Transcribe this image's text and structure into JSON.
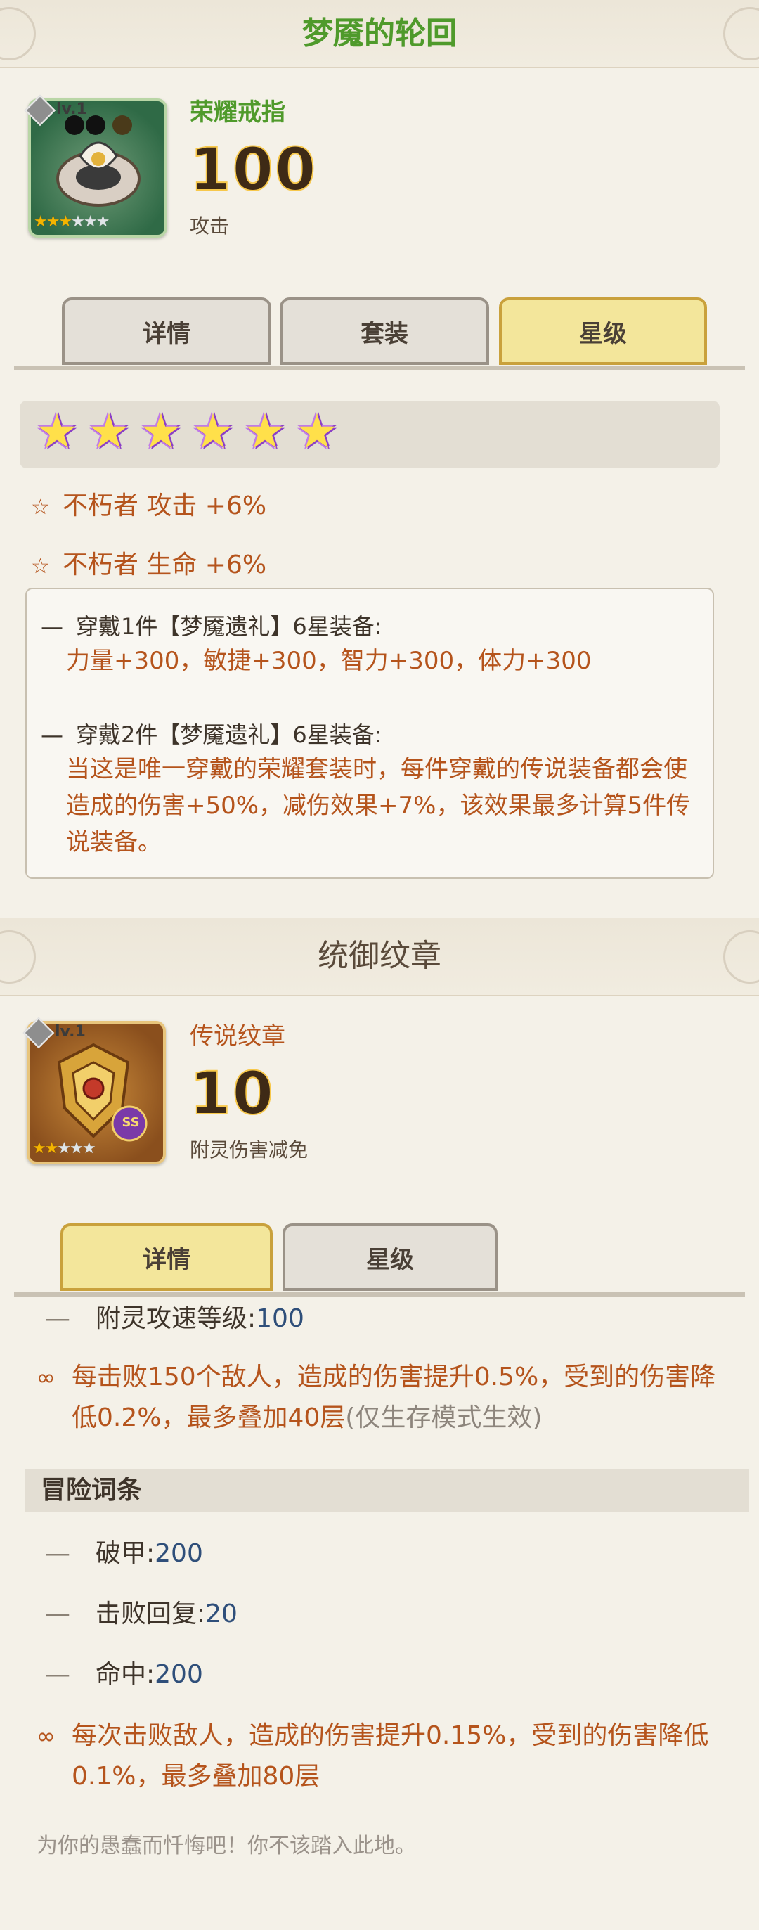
{
  "panel1": {
    "title": "梦魇的轮回",
    "item": {
      "level": "lv.1",
      "name": "荣耀戒指",
      "value": "100",
      "stat": "攻击",
      "stars_filled": 3,
      "stars_total": 6
    },
    "tabs": [
      {
        "label": "详情",
        "active": false
      },
      {
        "label": "套装",
        "active": false
      },
      {
        "label": "星级",
        "active": true
      }
    ],
    "star_count": 6,
    "bonuses": [
      "不朽者 攻击 +6%",
      "不朽者 生命 +6%"
    ],
    "set_bonuses": [
      {
        "head": "穿戴1件【梦魇遗礼】6星装备:",
        "body": "力量+300，敏捷+300，智力+300，体力+300"
      },
      {
        "head": "穿戴2件【梦魇遗礼】6星装备:",
        "body": "当这是唯一穿戴的荣耀套装时，每件穿戴的传说装备都会使造成的伤害+50%，减伤效果+7%，该效果最多计算5件传说装备。"
      }
    ]
  },
  "panel2": {
    "title": "统御纹章",
    "item": {
      "level": "lv.1",
      "name": "传说纹章",
      "value": "10",
      "stat": "附灵伤害减免",
      "badge": "SS",
      "stars_filled": 2,
      "stars_total": 5
    },
    "tabs": [
      {
        "label": "详情",
        "active": true
      },
      {
        "label": "星级",
        "active": false
      }
    ],
    "stats_top": [
      {
        "label": "附灵攻速等级:",
        "value": "100"
      }
    ],
    "effect1": {
      "main": "每击败150个敌人，造成的伤害提升0.5%，受到的伤害降低0.2%，最多叠加40层",
      "note": "(仅生存模式生效)"
    },
    "section_title": "冒险词条",
    "adventure_stats": [
      {
        "label": "破甲:",
        "value": "200"
      },
      {
        "label": "击败回复:",
        "value": "20"
      },
      {
        "label": "命中:",
        "value": "200"
      }
    ],
    "effect2": "每次击败敌人，造成的伤害提升0.15%，受到的伤害降低0.1%，最多叠加80层",
    "flavor": "为你的愚蠢而忏悔吧！你不该踏入此地。"
  },
  "colors": {
    "title_green": "#4f9a2b",
    "accent_orange": "#b5541c",
    "title_dark": "#5a4a3a",
    "tab_active": "#f3e69b",
    "tab_inactive": "#e4e0d8"
  }
}
